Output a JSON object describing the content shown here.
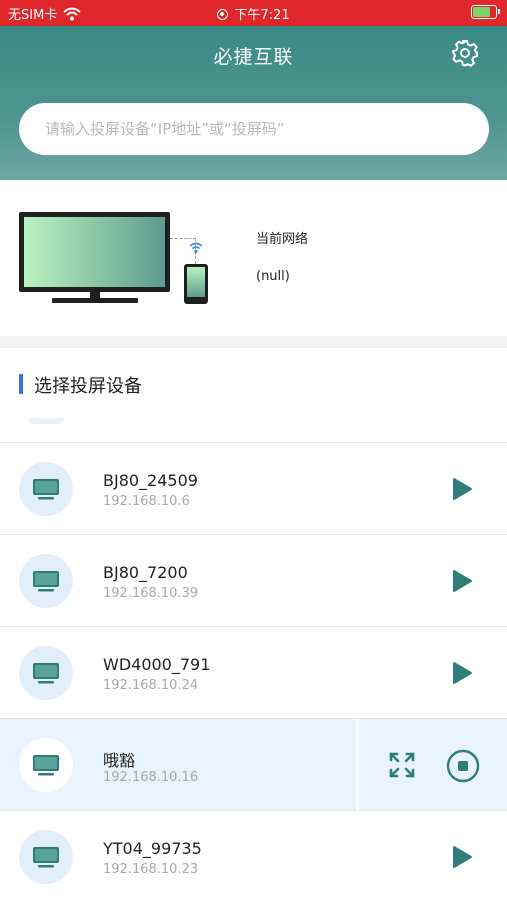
{
  "status_bar": {
    "carrier": "无SIM卡",
    "time": "下午7:21"
  },
  "header": {
    "title": "必捷互联",
    "search_placeholder": "请输入投屏设备“IP地址”或“投屏码”"
  },
  "network": {
    "label": "当前网络",
    "value": "(null)"
  },
  "section": {
    "title": "选择投屏设备"
  },
  "devices": [
    {
      "name": "BJ80_24509",
      "ip": "192.168.10.6",
      "state": "idle"
    },
    {
      "name": "BJ80_7200",
      "ip": "192.168.10.39",
      "state": "idle"
    },
    {
      "name": "WD4000_791",
      "ip": "192.168.10.24",
      "state": "idle"
    },
    {
      "name": "哦豁",
      "ip": "192.168.10.16",
      "state": "casting"
    },
    {
      "name": "YT04_99735",
      "ip": "192.168.10.23",
      "state": "idle"
    }
  ],
  "colors": {
    "status_bar": "#e0272b",
    "header": "#3a8a86",
    "accent_teal": "#2f7d78",
    "section_bar": "#3d6fe0",
    "active_row": "#e8f3fd"
  },
  "icons": [
    "wifi-icon",
    "location-icon",
    "battery-icon",
    "gear-icon",
    "tv-icon",
    "play-icon",
    "fullscreen-icon",
    "stop-icon"
  ]
}
